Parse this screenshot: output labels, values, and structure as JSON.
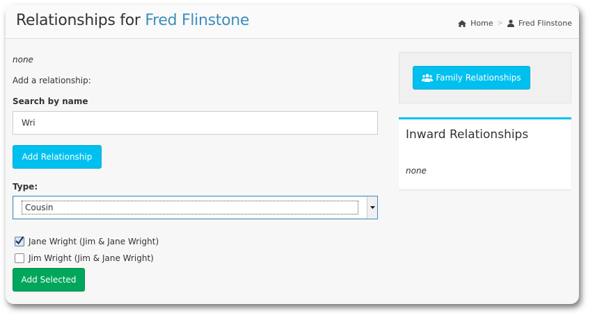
{
  "header": {
    "title_prefix": "Relationships for",
    "person_name": "Fred Flinstone",
    "breadcrumb": [
      {
        "label": "Home",
        "icon": "home-icon"
      },
      {
        "label": "Fred Flinstone",
        "icon": "user-icon"
      }
    ],
    "breadcrumb_separator": ">"
  },
  "main": {
    "current_relationships": "none",
    "add_relationship_label": "Add a relationship:",
    "search_label": "Search by name",
    "search_value": "Wri",
    "add_relationship_button": "Add Relationship",
    "type_label": "Type:",
    "type_selected": "Cousin",
    "candidates": [
      {
        "label": "Jane Wright (Jim & Jane Wright)",
        "checked": true
      },
      {
        "label": "Jim Wright (Jim & Jane Wright)",
        "checked": false
      }
    ],
    "add_selected_button": "Add Selected"
  },
  "sidebar": {
    "family_button": "Family Relationships",
    "inward_title": "Inward Relationships",
    "inward_value": "none"
  },
  "colors": {
    "accent_link": "#3c8dbc",
    "info_button": "#00c0ef",
    "success_button": "#00a65a"
  }
}
